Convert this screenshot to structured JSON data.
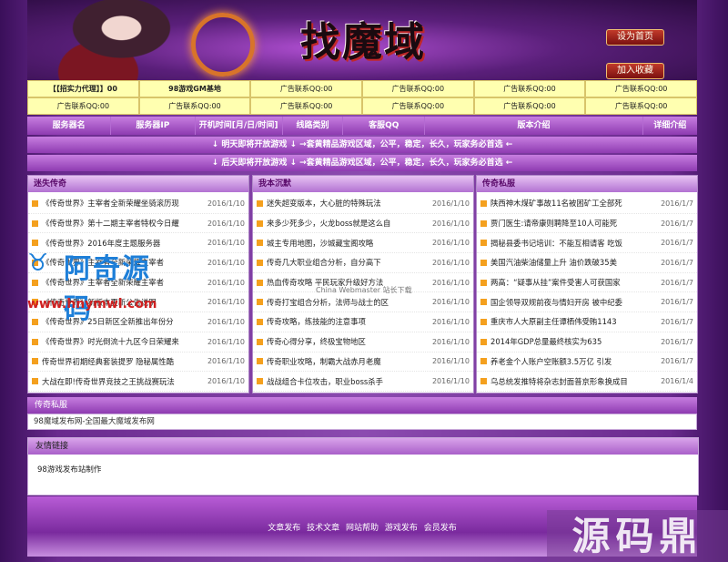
{
  "header": {
    "logo_text": "找魔域",
    "btn_home": "设为首页",
    "btn_fav": "加入收藏"
  },
  "ads": [
    "【【招实力代理】】00",
    "98游戏GM基地",
    "广告联系QQ:00",
    "广告联系QQ:00",
    "广告联系QQ:00",
    "广告联系QQ:00",
    "广告联系QQ:00",
    "广告联系QQ:00",
    "广告联系QQ:00",
    "广告联系QQ:00",
    "广告联系QQ:00",
    "广告联系QQ:00"
  ],
  "columns": [
    "服务器名",
    "服务器IP",
    "开机时间[月/日/时间]",
    "线路类别",
    "客服QQ",
    "版本介绍",
    "详细介绍"
  ],
  "notice1": "↓ 明天即将开放游戏 ↓ →套黄精品游戏区域，公平，稳定，长久，玩家务必首选 ←",
  "notice2": "↓ 后天即将开放游戏 ↓ →套黄精品游戏区域，公平，稳定，长久，玩家务必首选 ←",
  "panels": [
    {
      "title": "迷失传奇",
      "items": [
        {
          "t": "《传奇世界》主宰者全新荣耀坐骑滚历现",
          "d": "2016/1/10"
        },
        {
          "t": "《传奇世界》第十二期主宰者特权今日耀",
          "d": "2016/1/10"
        },
        {
          "t": "《传奇世界》2016年度主题服务器",
          "d": "2016/1/10"
        },
        {
          "t": "《传奇世界》主宰者全新荣耀主宰者",
          "d": "2016/1/10"
        },
        {
          "t": "《传奇世界》主宰者全新荣耀主宰者",
          "d": "2016/1/10"
        },
        {
          "t": "《传奇世界》新版本更新公告说明",
          "d": "2016/1/10"
        },
        {
          "t": "《传奇世界》25日新区全新推出年份分",
          "d": "2016/1/10"
        },
        {
          "t": "《传奇世界》时光倒流十九区今日荣耀来",
          "d": "2016/1/10"
        },
        {
          "t": "传奇世界初期经典套装提罗 隐秘属性酷",
          "d": "2016/1/10"
        },
        {
          "t": "大战在即!传奇世界竞技之王挑战赛玩法",
          "d": "2016/1/10"
        }
      ]
    },
    {
      "title": "我本沉默",
      "items": [
        {
          "t": "迷失超变版本，大心脏的特殊玩法",
          "d": "2016/1/10"
        },
        {
          "t": "来多少死多少，火龙boss就是这么自",
          "d": "2016/1/10"
        },
        {
          "t": "城主专用地图，沙城藏宝阁攻略",
          "d": "2016/1/10"
        },
        {
          "t": "传奇几大职业组合分析，自分高下",
          "d": "2016/1/10"
        },
        {
          "t": "热血传奇攻略 平民玩家升级好方法",
          "d": "2016/1/10"
        },
        {
          "t": "传奇打宝组合分析，法师与战士的区",
          "d": "2016/1/10"
        },
        {
          "t": "传奇攻略，练技能的注意事项",
          "d": "2016/1/10"
        },
        {
          "t": "传奇心得分享，终极宝物地区",
          "d": "2016/1/10"
        },
        {
          "t": "传奇职业攻略，制霸大战赤月老魔",
          "d": "2016/1/10"
        },
        {
          "t": "战战组合卡位攻击，职业boss杀手",
          "d": "2016/1/10"
        }
      ]
    },
    {
      "title": "传奇私服",
      "items": [
        {
          "t": "陕西神木煤矿事故11名被困矿工全部死",
          "d": "2016/1/7"
        },
        {
          "t": "贾门医生:请帝康则聘降至10人可能死",
          "d": "2016/1/7"
        },
        {
          "t": "揭秘县委书记培训：不能互相请客 吃饭",
          "d": "2016/1/7"
        },
        {
          "t": "美国汽油柴油储量上升 油价跌破35美",
          "d": "2016/1/7"
        },
        {
          "t": "两高：“疑事从挂”案件受害人可获国家",
          "d": "2016/1/7"
        },
        {
          "t": "国企领导双规前夜与情妇开房 被中纪委",
          "d": "2016/1/7"
        },
        {
          "t": "重庆市人大原副主任谭栖伟受贿1143",
          "d": "2016/1/7"
        },
        {
          "t": "2014年GDP总量最终核实为635",
          "d": "2016/1/7"
        },
        {
          "t": "养老金个人账户空账额3.5万亿 引发",
          "d": "2016/1/7"
        },
        {
          "t": "乌总统发推特将杂志封面普京形象换成目",
          "d": "2016/1/4"
        }
      ]
    }
  ],
  "bar1": {
    "title": "传奇私服",
    "body": "98魔域发布网-全国最大魔域发布网"
  },
  "links": {
    "title": "友情链接",
    "body": "98游戏发布站制作"
  },
  "footer": [
    "文章发布",
    "技术文章",
    "网站帮助",
    "游戏发布",
    "会员发布"
  ],
  "watermarks": {
    "brand": "阿奇源码",
    "url": "www.hnymwl.com",
    "china": "China Webmaster 站长下载",
    "corner": "源码鼎"
  }
}
